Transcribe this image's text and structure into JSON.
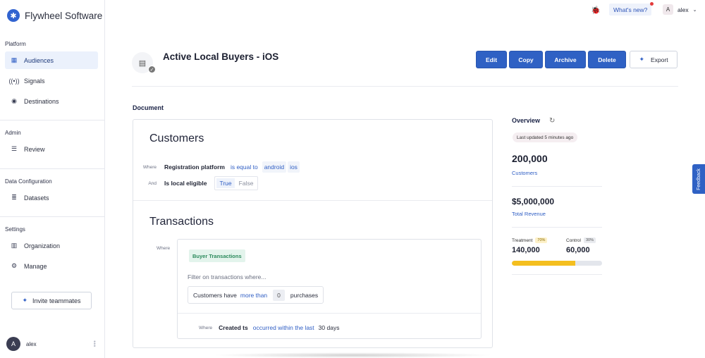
{
  "brand": {
    "name": "Flywheel Software",
    "logo_icon": "asterisk-logo-icon",
    "accent": "#2f61c4"
  },
  "sidebar": {
    "sections": [
      {
        "title": "Platform",
        "items": [
          {
            "label": "Audiences",
            "icon": "grid-icon",
            "active": true
          },
          {
            "label": "Signals",
            "icon": "broadcast-icon"
          },
          {
            "label": "Destinations",
            "icon": "compass-icon"
          }
        ]
      },
      {
        "title": "Admin",
        "items": [
          {
            "label": "Review",
            "icon": "list-icon"
          }
        ]
      },
      {
        "title": "Data Configuration",
        "items": [
          {
            "label": "Datasets",
            "icon": "table-list-icon"
          }
        ]
      },
      {
        "title": "Settings",
        "items": [
          {
            "label": "Organization",
            "icon": "building-icon"
          },
          {
            "label": "Manage",
            "icon": "gear-icon"
          }
        ]
      }
    ],
    "invite_label": "Invite teammates",
    "user": {
      "initial": "A",
      "name": "alex"
    }
  },
  "topbar": {
    "whats_new": "What's new?",
    "user_initial": "A",
    "user_name": "alex"
  },
  "header": {
    "title": "Active Local Buyers - iOS",
    "actions": {
      "edit": "Edit",
      "copy": "Copy",
      "archive": "Archive",
      "delete": "Delete",
      "export": "Export"
    }
  },
  "document": {
    "label": "Document",
    "customers": {
      "heading": "Customers",
      "row1": {
        "keyword": "Where",
        "field": "Registration platform",
        "operator": "is equal to",
        "values": [
          "android",
          "ios"
        ]
      },
      "row2": {
        "keyword": "And",
        "field": "Is local eligible",
        "options": [
          "True",
          "False"
        ],
        "selected": "True"
      }
    },
    "transactions": {
      "heading": "Transactions",
      "where": "Where",
      "source": "Buyer Transactions",
      "filter_hint": "Filter on transactions where...",
      "purchases": {
        "prefix": "Customers have",
        "operator": "more than",
        "count": "0",
        "suffix": "purchases"
      },
      "time_cond": {
        "keyword": "Where",
        "field": "Created ts",
        "operator": "occurred within the last",
        "value": "30 days"
      }
    }
  },
  "overview": {
    "title": "Overview",
    "last_updated": "Last updated 5 minutes ago",
    "customers": {
      "value": "200,000",
      "label": "Customers"
    },
    "revenue": {
      "value": "$5,000,000",
      "label": "Total Revenue"
    },
    "treatment": {
      "label": "Treatment",
      "pct": "70%",
      "value": "140,000"
    },
    "control": {
      "label": "Control",
      "pct": "30%",
      "value": "60,000"
    },
    "treatment_fraction": 0.7
  },
  "feedback": "Feedback"
}
